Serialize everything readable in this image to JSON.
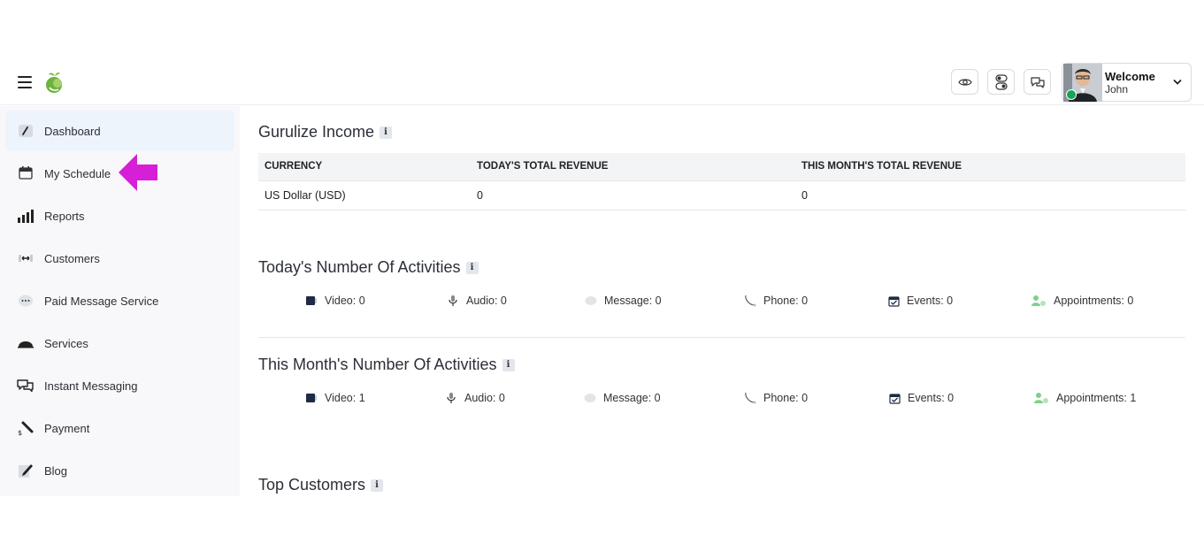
{
  "header": {
    "welcome": "Welcome",
    "username": "John"
  },
  "sidebar": {
    "items": [
      {
        "label": "Dashboard",
        "icon": "speedometer-icon"
      },
      {
        "label": "My Schedule",
        "icon": "calendar-icon"
      },
      {
        "label": "Reports",
        "icon": "bar-chart-icon"
      },
      {
        "label": "Customers",
        "icon": "handshake-icon"
      },
      {
        "label": "Paid Message Service",
        "icon": "chat-dots-icon"
      },
      {
        "label": "Services",
        "icon": "cloche-icon"
      },
      {
        "label": "Instant Messaging",
        "icon": "chat-bubbles-icon"
      },
      {
        "label": "Payment",
        "icon": "payment-icon"
      },
      {
        "label": "Blog",
        "icon": "edit-icon"
      }
    ]
  },
  "main": {
    "income": {
      "title": "Gurulize Income",
      "info": "i",
      "headers": [
        "CURRENCY",
        "TODAY'S TOTAL REVENUE",
        "THIS MONTH'S TOTAL REVENUE"
      ],
      "rows": [
        [
          "US Dollar (USD)",
          "0",
          "0"
        ]
      ]
    },
    "today": {
      "title": "Today's Number Of Activities",
      "info": "i",
      "items": [
        "Video: 0",
        "Audio: 0",
        "Message: 0",
        "Phone: 0",
        "Events: 0",
        "Appointments: 0"
      ]
    },
    "month": {
      "title": "This Month's Number Of Activities",
      "info": "i",
      "items": [
        "Video: 1",
        "Audio: 0",
        "Message: 0",
        "Phone: 0",
        "Events: 0",
        "Appointments: 1"
      ]
    },
    "top_customers": {
      "title": "Top Customers",
      "info": "i"
    }
  },
  "colors": {
    "accent_arrow": "#d61fd6",
    "active_nav_bg": "#edf4fc",
    "online": "#17a35a",
    "appointment_icon": "#7fcf8a"
  }
}
